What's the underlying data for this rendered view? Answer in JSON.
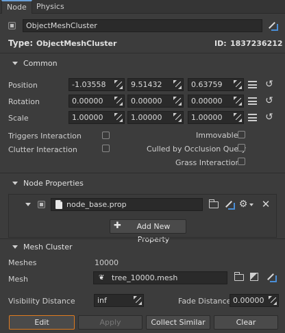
{
  "tabs": [
    {
      "label": "Node"
    },
    {
      "label": "Physics"
    }
  ],
  "node_name": "ObjectMeshCluster",
  "type_label": "Type:",
  "type_value": "ObjectMeshCluster",
  "id_label": "ID:",
  "id_value": "1837236212",
  "common": {
    "title": "Common",
    "position": {
      "label": "Position",
      "x": "-1.03558",
      "y": "9.51432",
      "z": "0.63759"
    },
    "rotation": {
      "label": "Rotation",
      "x": "0.00000",
      "y": "0.00000",
      "z": "0.00000"
    },
    "scale": {
      "label": "Scale",
      "x": "1.00000",
      "y": "1.00000",
      "z": "1.00000"
    },
    "triggers": "Triggers Interaction",
    "clutter": "Clutter Interaction",
    "immovable": "Immovable",
    "culled": "Culled by Occlusion Query",
    "grass": "Grass Interaction"
  },
  "node_properties": {
    "title": "Node Properties",
    "prop_file": "node_base.prop",
    "add_button": "Add New Property"
  },
  "mesh_cluster": {
    "title": "Mesh Cluster",
    "meshes_label": "Meshes",
    "meshes_value": "10000",
    "mesh_label": "Mesh",
    "mesh_file": "tree_10000.mesh",
    "visibility_label": "Visibility Distance",
    "visibility_value": "inf",
    "fade_label": "Fade Distance",
    "fade_value": "0.00000"
  },
  "buttons": {
    "edit": "Edit",
    "apply": "Apply",
    "collect": "Collect Similar",
    "clear": "Clear"
  },
  "colors": {
    "accent": "#e07b1f",
    "tab_highlight": "#6aa0d8",
    "background": "#3c3c3c"
  }
}
